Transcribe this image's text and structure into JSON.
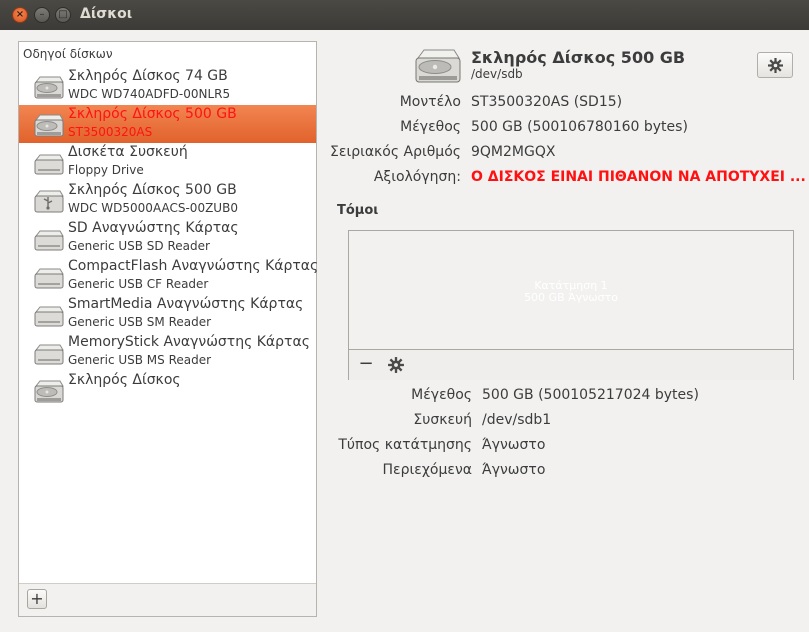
{
  "window": {
    "title": "Δίσκοι",
    "close_glyph": "×",
    "min_glyph": "–",
    "max_glyph": "□"
  },
  "sidebar": {
    "header": "Οδηγοί δίσκων",
    "add_label": "+",
    "items": [
      {
        "name": "Σκληρός Δίσκος 74 GB",
        "sub": "WDC WD740ADFD-00NLR5",
        "icon": "hard-disk-icon",
        "selected": false
      },
      {
        "name": "Σκληρός Δίσκος 500 GB",
        "sub": "ST3500320AS",
        "icon": "hard-disk-icon",
        "selected": true
      },
      {
        "name": "Δισκέτα Συσκευή",
        "sub": "Floppy Drive",
        "icon": "floppy-drive-icon",
        "selected": false
      },
      {
        "name": "Σκληρός Δίσκος 500 GB",
        "sub": "WDC WD5000AACS-00ZUB0",
        "icon": "usb-disk-icon",
        "selected": false
      },
      {
        "name": "SD Αναγνώστης Κάρτας",
        "sub": "Generic USB SD Reader",
        "icon": "card-reader-icon",
        "selected": false
      },
      {
        "name": "CompactFlash Αναγνώστης Κάρτας",
        "sub": "Generic USB CF Reader",
        "icon": "card-reader-icon",
        "selected": false
      },
      {
        "name": "SmartMedia Αναγνώστης Κάρτας",
        "sub": "Generic USB SM Reader",
        "icon": "card-reader-icon",
        "selected": false
      },
      {
        "name": "MemoryStick Αναγνώστης Κάρτας",
        "sub": "Generic USB MS Reader",
        "icon": "card-reader-icon",
        "selected": false
      },
      {
        "name": "Σκληρός Δίσκος",
        "sub": "",
        "icon": "hard-disk-icon",
        "selected": false
      }
    ]
  },
  "drive": {
    "title": "Σκληρός Δίσκος 500 GB",
    "device": "/dev/sdb",
    "properties": [
      {
        "label": "Μοντέλο",
        "value": "ST3500320AS (SD15)",
        "alert": false
      },
      {
        "label": "Μέγεθος",
        "value": "500 GB (500106780160 bytes)",
        "alert": false
      },
      {
        "label": "Σειριακός Αριθμός",
        "value": "9QM2MGQX",
        "alert": false
      },
      {
        "label": "Αξιολόγηση:",
        "value": "Ο ΔΙΣΚΟΣ ΕΙΝΑΙ ΠΙΘΑΝΟΝ ΝΑ ΑΠΟΤΥΧΕΙ ...",
        "alert": true
      }
    ]
  },
  "volumes": {
    "title": "Τόμοι",
    "partition_name": "Κατάτμηση 1",
    "partition_size": "500 GB Άγνωστο",
    "remove_label": "−",
    "properties": [
      {
        "label": "Μέγεθος",
        "value": "500 GB (500105217024 bytes)"
      },
      {
        "label": "Συσκευή",
        "value": "/dev/sdb1"
      },
      {
        "label": "Τύπος κατάτμησης",
        "value": "Άγνωστο"
      },
      {
        "label": "Περιεχόμενα",
        "value": "Άγνωστο"
      }
    ]
  },
  "colors": {
    "selection": "#e8703a",
    "alert": "#ff1111",
    "titlebar": "#3c3b37"
  }
}
